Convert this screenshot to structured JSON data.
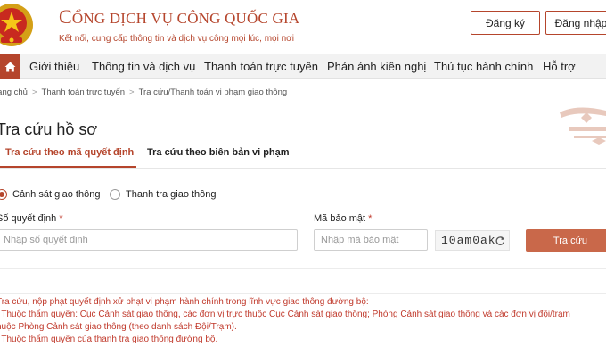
{
  "header": {
    "brand_prefix": "C",
    "brand_title": "ỔNG DỊCH VỤ CÔNG QUỐC GIA",
    "tagline": "Kết nối, cung cấp thông tin và dịch vụ công mọi lúc, mọi nơi",
    "register_label": "Đăng ký",
    "login_label": "Đăng nhập"
  },
  "nav": {
    "home_icon": "home-icon",
    "items": [
      {
        "label": "Giới thiệu"
      },
      {
        "label": "Thông tin và dịch vụ"
      },
      {
        "label": "Thanh toán trực tuyến"
      },
      {
        "label": "Phản ánh kiến nghị"
      },
      {
        "label": "Thủ tục hành chính"
      },
      {
        "label": "Hỗ trợ"
      }
    ]
  },
  "breadcrumb": [
    "rang chủ",
    "Thanh toán trực tuyến",
    "Tra cứu/Thanh toán vi phạm giao thông"
  ],
  "page": {
    "title": "Tra cứu hồ sơ"
  },
  "tabs": [
    {
      "label": "Tra cứu theo mã quyết định",
      "active": true
    },
    {
      "label": "Tra cứu theo biên bản vi phạm",
      "active": false
    }
  ],
  "radios": [
    {
      "label": "Cảnh sát giao thông",
      "checked": true
    },
    {
      "label": "Thanh tra giao thông",
      "checked": false
    }
  ],
  "form": {
    "decision_label": "Số quyết định",
    "decision_placeholder": "Nhập số quyết định",
    "security_label": "Mã bảo mật",
    "security_placeholder": "Nhập mã bảo mật",
    "required_mark": "*",
    "captcha": "10am0ak",
    "search_label": "Tra cứu"
  },
  "notes": [
    "Tra cứu, nộp phạt quyết định xử phạt vi phạm hành chính trong lĩnh vực giao thông đường bộ:",
    ". Thuộc thẩm quyền: Cục Cảnh sát giao thông, các đơn vị trực thuộc Cục Cảnh sát giao thông; Phòng Cảnh sát giao thông và các đơn vị đội/trạm",
    "huộc Phòng Cảnh sát giao thông (theo danh sách Đội/Trạm).",
    ". Thuộc thẩm quyền của thanh tra giao thông đường bộ."
  ],
  "colors": {
    "brand": "#b5452c",
    "button": "#c9684a",
    "note_text": "#c0392b"
  }
}
